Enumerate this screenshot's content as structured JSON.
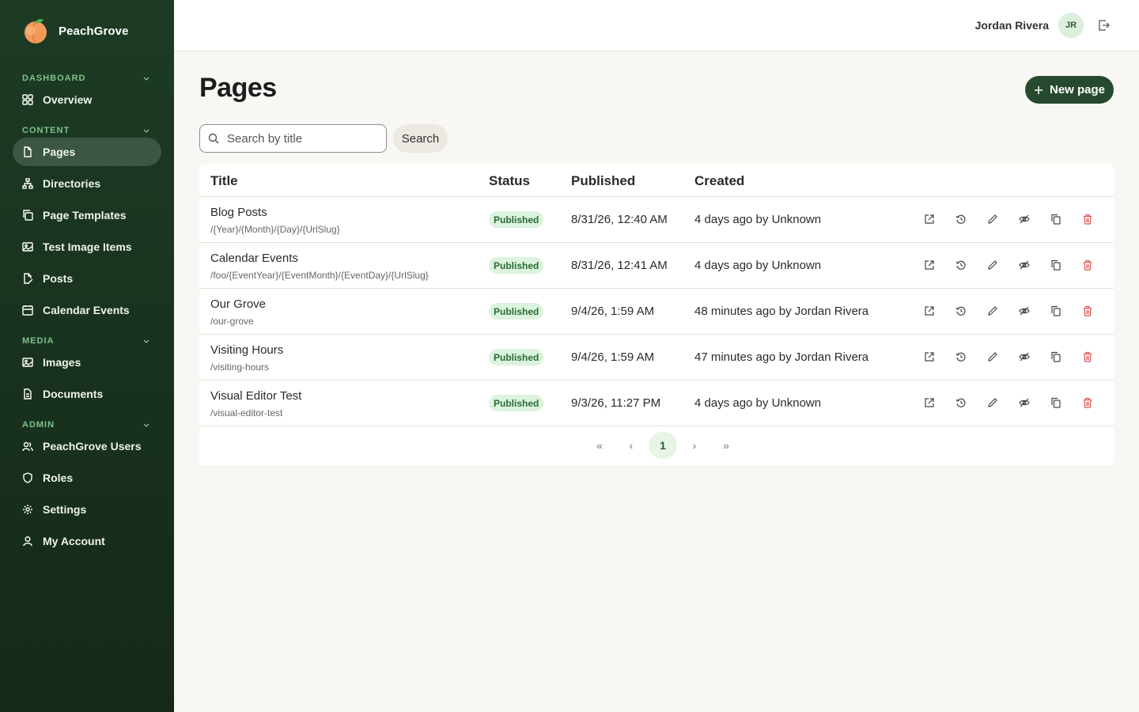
{
  "app": {
    "name": "PeachGrove"
  },
  "sidebar": {
    "sections": [
      {
        "label": "DASHBOARD"
      },
      {
        "label": "CONTENT"
      },
      {
        "label": "MEDIA"
      },
      {
        "label": "ADMIN"
      }
    ],
    "items": [
      {
        "label": "Overview",
        "icon": "grid-icon"
      },
      {
        "label": "Pages",
        "icon": "file-icon",
        "active": true
      },
      {
        "label": "Directories",
        "icon": "sitemap-icon"
      },
      {
        "label": "Page Templates",
        "icon": "copy-icon"
      },
      {
        "label": "Test Image Items",
        "icon": "image-icon"
      },
      {
        "label": "Posts",
        "icon": "file-edit-icon"
      },
      {
        "label": "Calendar Events",
        "icon": "calendar-icon"
      },
      {
        "label": "Images",
        "icon": "image-icon"
      },
      {
        "label": "Documents",
        "icon": "document-icon"
      },
      {
        "label": "PeachGrove Users",
        "icon": "users-icon"
      },
      {
        "label": "Roles",
        "icon": "shield-icon"
      },
      {
        "label": "Settings",
        "icon": "gear-icon"
      },
      {
        "label": "My Account",
        "icon": "user-icon"
      }
    ]
  },
  "topbar": {
    "user_name": "Jordan Rivera",
    "avatar_initials": "JR"
  },
  "main": {
    "title": "Pages",
    "new_button": "New page",
    "search": {
      "placeholder": "Search by title",
      "value": "",
      "button": "Search"
    }
  },
  "table": {
    "columns": [
      "Title",
      "Status",
      "Published",
      "Created"
    ],
    "rows": [
      {
        "title": "Blog Posts",
        "slug": "/{Year}/{Month}/{Day}/{UrlSlug}",
        "status": "Published",
        "published": "8/31/26, 12:40 AM",
        "created": "4 days ago by Unknown"
      },
      {
        "title": "Calendar Events",
        "slug": "/foo/{EventYear}/{EventMonth}/{EventDay}/{UrlSlug}",
        "status": "Published",
        "published": "8/31/26, 12:41 AM",
        "created": "4 days ago by Unknown"
      },
      {
        "title": "Our Grove",
        "slug": "/our-grove",
        "status": "Published",
        "published": "9/4/26, 1:59 AM",
        "created": "48 minutes ago by Jordan Rivera"
      },
      {
        "title": "Visiting Hours",
        "slug": "/visiting-hours",
        "status": "Published",
        "published": "9/4/26, 1:59 AM",
        "created": "47 minutes ago by Jordan Rivera"
      },
      {
        "title": "Visual Editor Test",
        "slug": "/visual-editor-test",
        "status": "Published",
        "published": "9/3/26, 11:27 PM",
        "created": "4 days ago by Unknown"
      }
    ],
    "row_actions": [
      "open-external-icon",
      "history-icon",
      "edit-icon",
      "unpublish-icon",
      "duplicate-icon",
      "delete-icon"
    ]
  },
  "pagination": {
    "first": "«",
    "prev": "‹",
    "current": "1",
    "next": "›",
    "last": "»"
  },
  "colors": {
    "sidebar": "#1d3b24",
    "accent": "#264a2e",
    "badge_bg": "#dcf3de",
    "delete": "#e05252"
  }
}
